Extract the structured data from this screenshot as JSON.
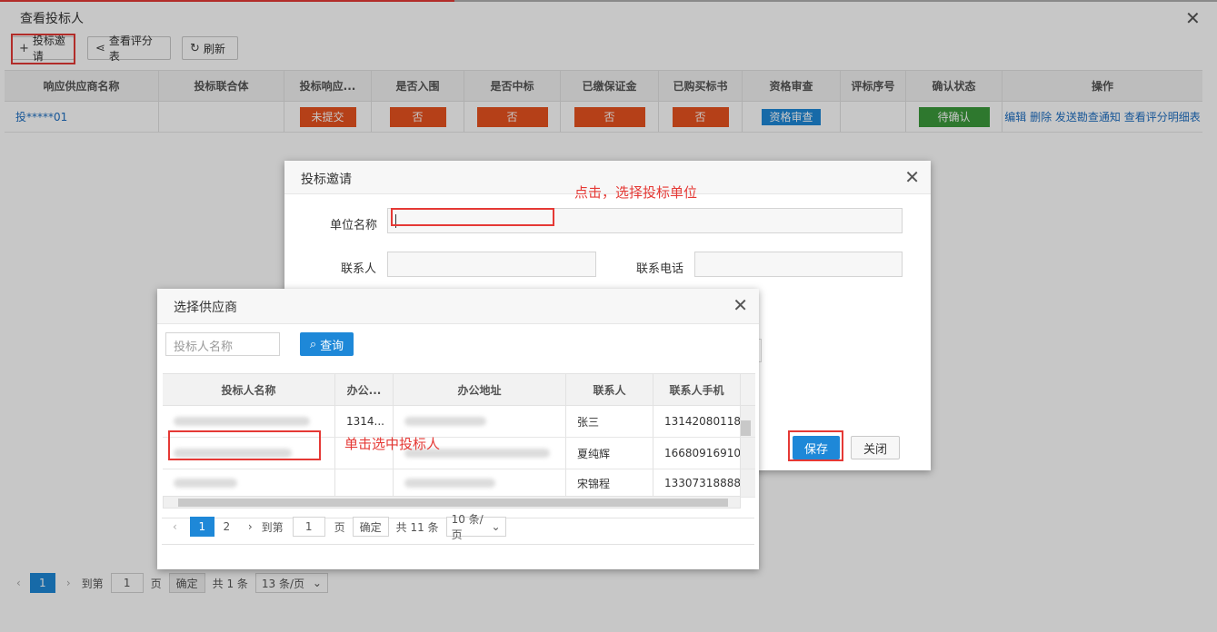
{
  "window": {
    "title": "查看投标人"
  },
  "toolbar": {
    "invite": "投标邀请",
    "view_scores": "查看评分表",
    "refresh": "刷新"
  },
  "main_table": {
    "headers": [
      "响应供应商名称",
      "投标联合体",
      "投标响应...",
      "是否入围",
      "是否中标",
      "已缴保证金",
      "已购买标书",
      "资格审查",
      "评标序号",
      "确认状态",
      "操作"
    ],
    "row": {
      "supplier": "投*****01",
      "response": "未提交",
      "shortlisted": "否",
      "won": "否",
      "deposit": "否",
      "bought": "否",
      "review": "资格审查",
      "status": "待确认",
      "ops": [
        "编辑",
        "删除",
        "发送勘查通知",
        "查看评分明细表"
      ]
    }
  },
  "main_pagination": {
    "page": "1",
    "goto": "到第",
    "goto_val": "1",
    "page_unit": "页",
    "confirm": "确定",
    "total": "共 1 条",
    "per_page": "13 条/页"
  },
  "invite_dialog": {
    "title": "投标邀请",
    "unit_label": "单位名称",
    "contact_label": "联系人",
    "phone_label": "联系电话",
    "save": "保存",
    "close": "关闭"
  },
  "annotations": {
    "click_select": "点击，选择投标单位",
    "single_click": "单击选中投标人"
  },
  "supplier_dialog": {
    "title": "选择供应商",
    "search_placeholder": "投标人名称",
    "query": "查询",
    "headers": [
      "投标人名称",
      "办公...",
      "办公地址",
      "联系人",
      "联系人手机"
    ],
    "rows": [
      {
        "office": "1314...",
        "contact": "张三",
        "phone": "13142080118"
      },
      {
        "office": "",
        "contact": "夏纯辉",
        "phone": "16680916910"
      },
      {
        "office": "",
        "contact": "宋锦程",
        "phone": "13307318888"
      }
    ],
    "pagination": {
      "p1": "1",
      "p2": "2",
      "goto": "到第",
      "goto_val": "1",
      "page_unit": "页",
      "confirm": "确定",
      "total": "共 11 条",
      "per_page": "10 条/页"
    }
  },
  "colors": {
    "accent": "#1e88d8",
    "danger": "#e8531f",
    "success": "#3c9a3c",
    "annotation": "#e53935"
  }
}
